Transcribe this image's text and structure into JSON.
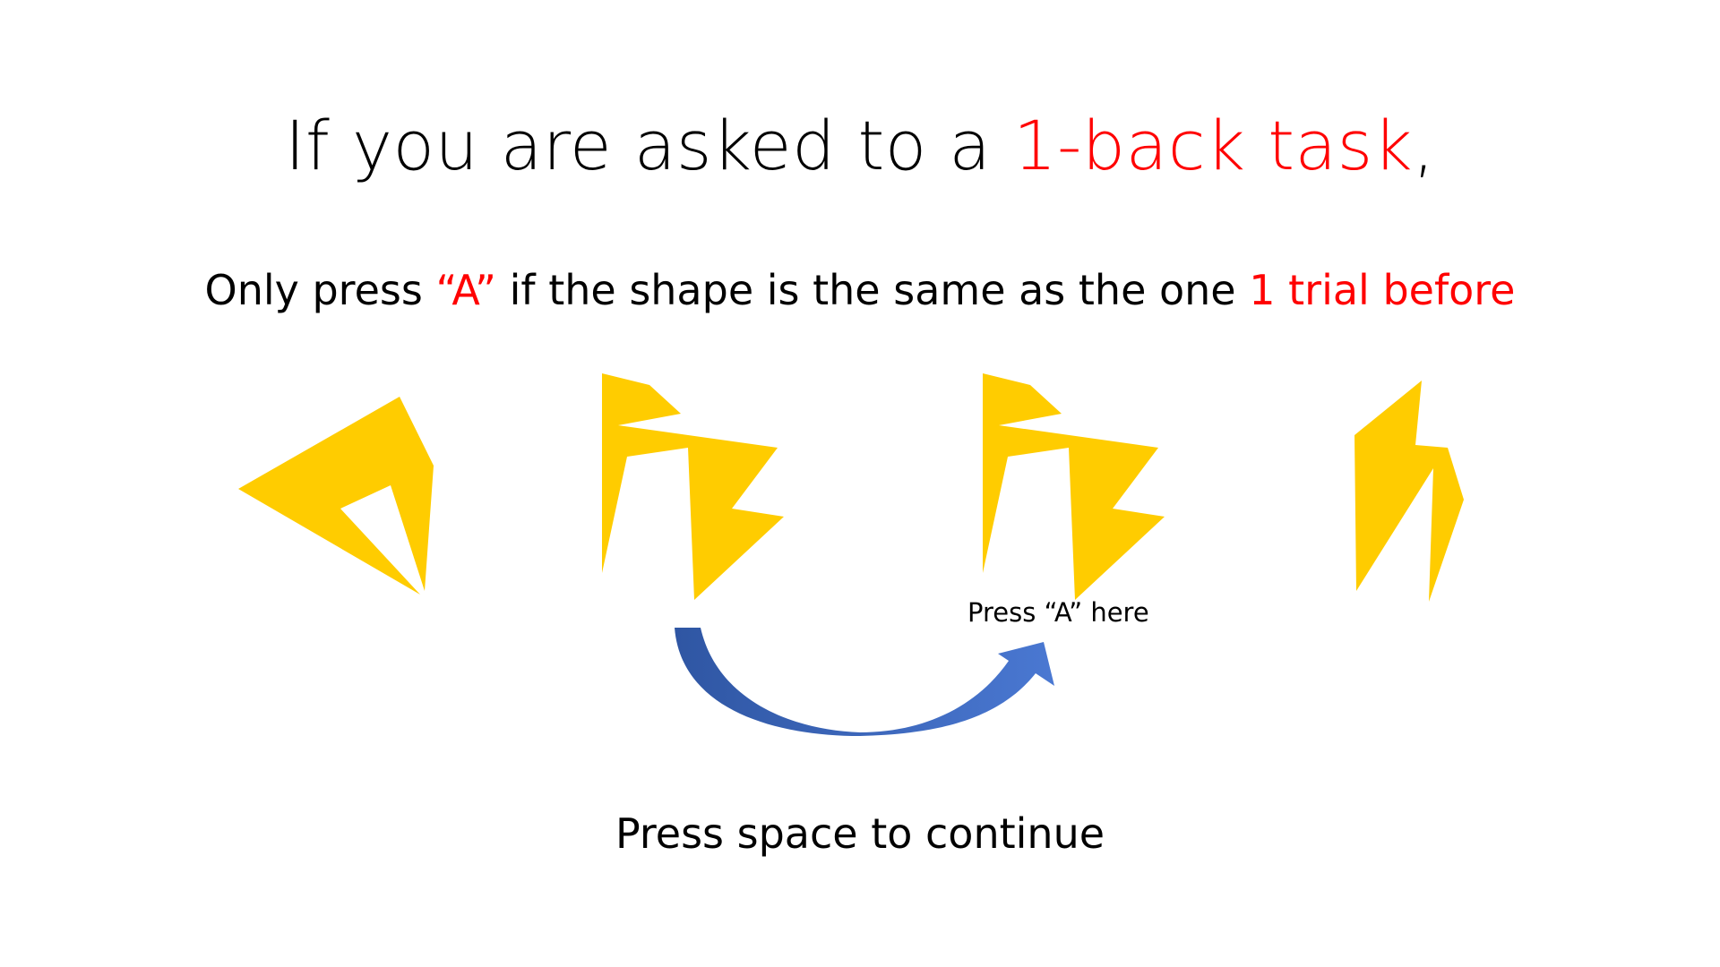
{
  "title": {
    "text_before": "If you are asked to a ",
    "text_highlight": "1-back task",
    "text_after": ","
  },
  "instruction": {
    "part1": "Only press ",
    "key_label": "“A”",
    "part2": " if the shape is the same as the one ",
    "highlight": "1 trial before"
  },
  "sequence_shapes": [
    "shape-arrowhead",
    "shape-zigzag",
    "shape-zigzag",
    "shape-lightning"
  ],
  "hint_label": "Press “A” here",
  "footer": "Press space to continue",
  "colors": {
    "text": "#000000",
    "highlight": "#ff0000",
    "shape_fill": "#ffcc00",
    "arrow_fill": "#3a62b5"
  }
}
